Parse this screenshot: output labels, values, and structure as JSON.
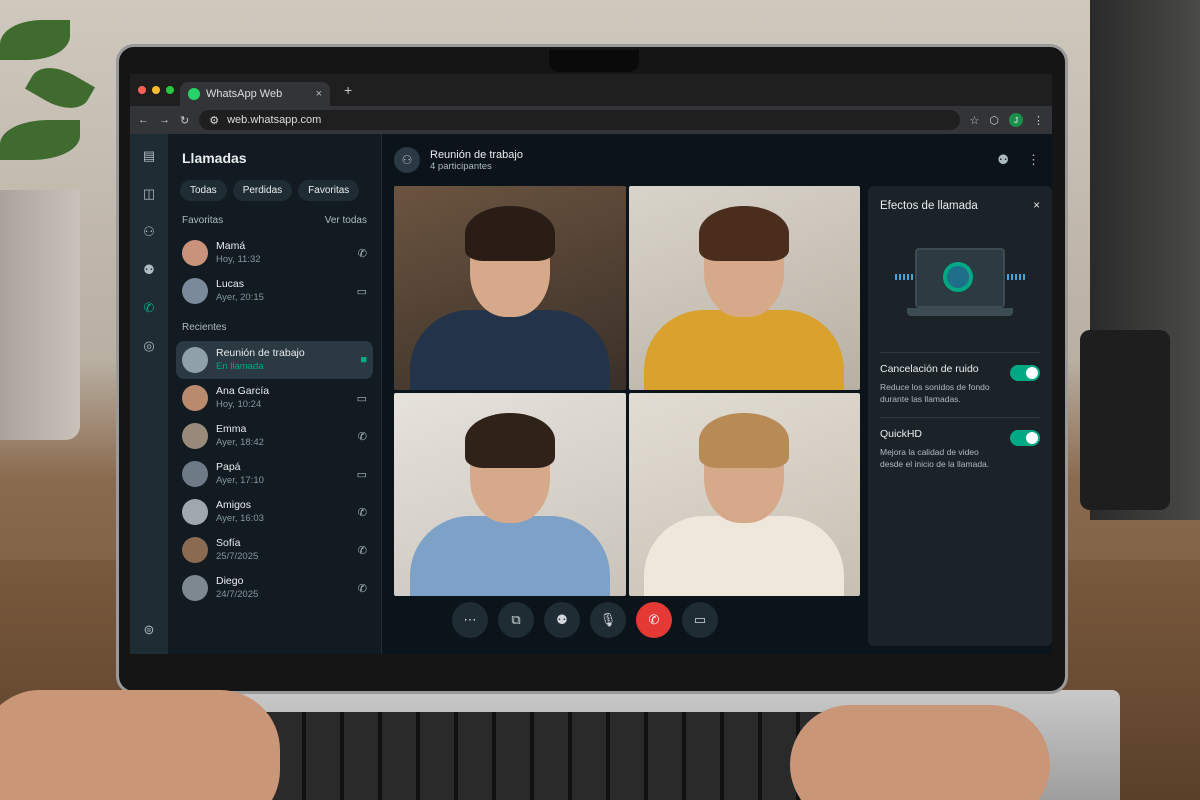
{
  "browser": {
    "tab_title": "WhatsApp Web",
    "tab_close": "×",
    "new_tab": "+",
    "url": "web.whatsapp.com",
    "profile_initial": "J"
  },
  "sidebar": {
    "title": "Llamadas",
    "filters": [
      "Todas",
      "Perdidas",
      "Favoritas"
    ],
    "favorites_heading": "Favoritas",
    "see_all": "Ver todas",
    "favorites": [
      {
        "name": "Mamá",
        "time": "Hoy, 11:32",
        "icon": "phone-icon"
      },
      {
        "name": "Lucas",
        "time": "Ayer, 20:15",
        "icon": "video-icon"
      }
    ],
    "recents_heading": "Recientes",
    "recents": [
      {
        "name": "Reunión de trabajo",
        "time": "En llamada",
        "icon": "video-icon"
      },
      {
        "name": "Ana García",
        "time": "Hoy, 10:24",
        "icon": "video-icon"
      },
      {
        "name": "Emma",
        "time": "Ayer, 18:42",
        "icon": "phone-icon"
      },
      {
        "name": "Papá",
        "time": "Ayer, 17:10",
        "icon": "video-icon"
      },
      {
        "name": "Amigos",
        "time": "Ayer, 16:03",
        "icon": "phone-icon"
      },
      {
        "name": "Sofía",
        "time": "25/7/2025",
        "icon": "phone-icon"
      },
      {
        "name": "Diego",
        "time": "24/7/2025",
        "icon": "phone-icon"
      }
    ]
  },
  "call": {
    "title": "Reunión de trabajo",
    "participants": "4 participantes"
  },
  "effects": {
    "title": "Efectos de llamada",
    "close": "×",
    "noise_title": "Cancelación de ruido",
    "noise_desc": "Reduce los sonidos de fondo durante las llamadas.",
    "noise_on": true,
    "hd_title": "QuickHD",
    "hd_desc": "Mejora la calidad de video desde el inicio de la llamada.",
    "hd_on": true
  },
  "colors": {
    "accent": "#00a884",
    "end_call": "#e53935"
  }
}
